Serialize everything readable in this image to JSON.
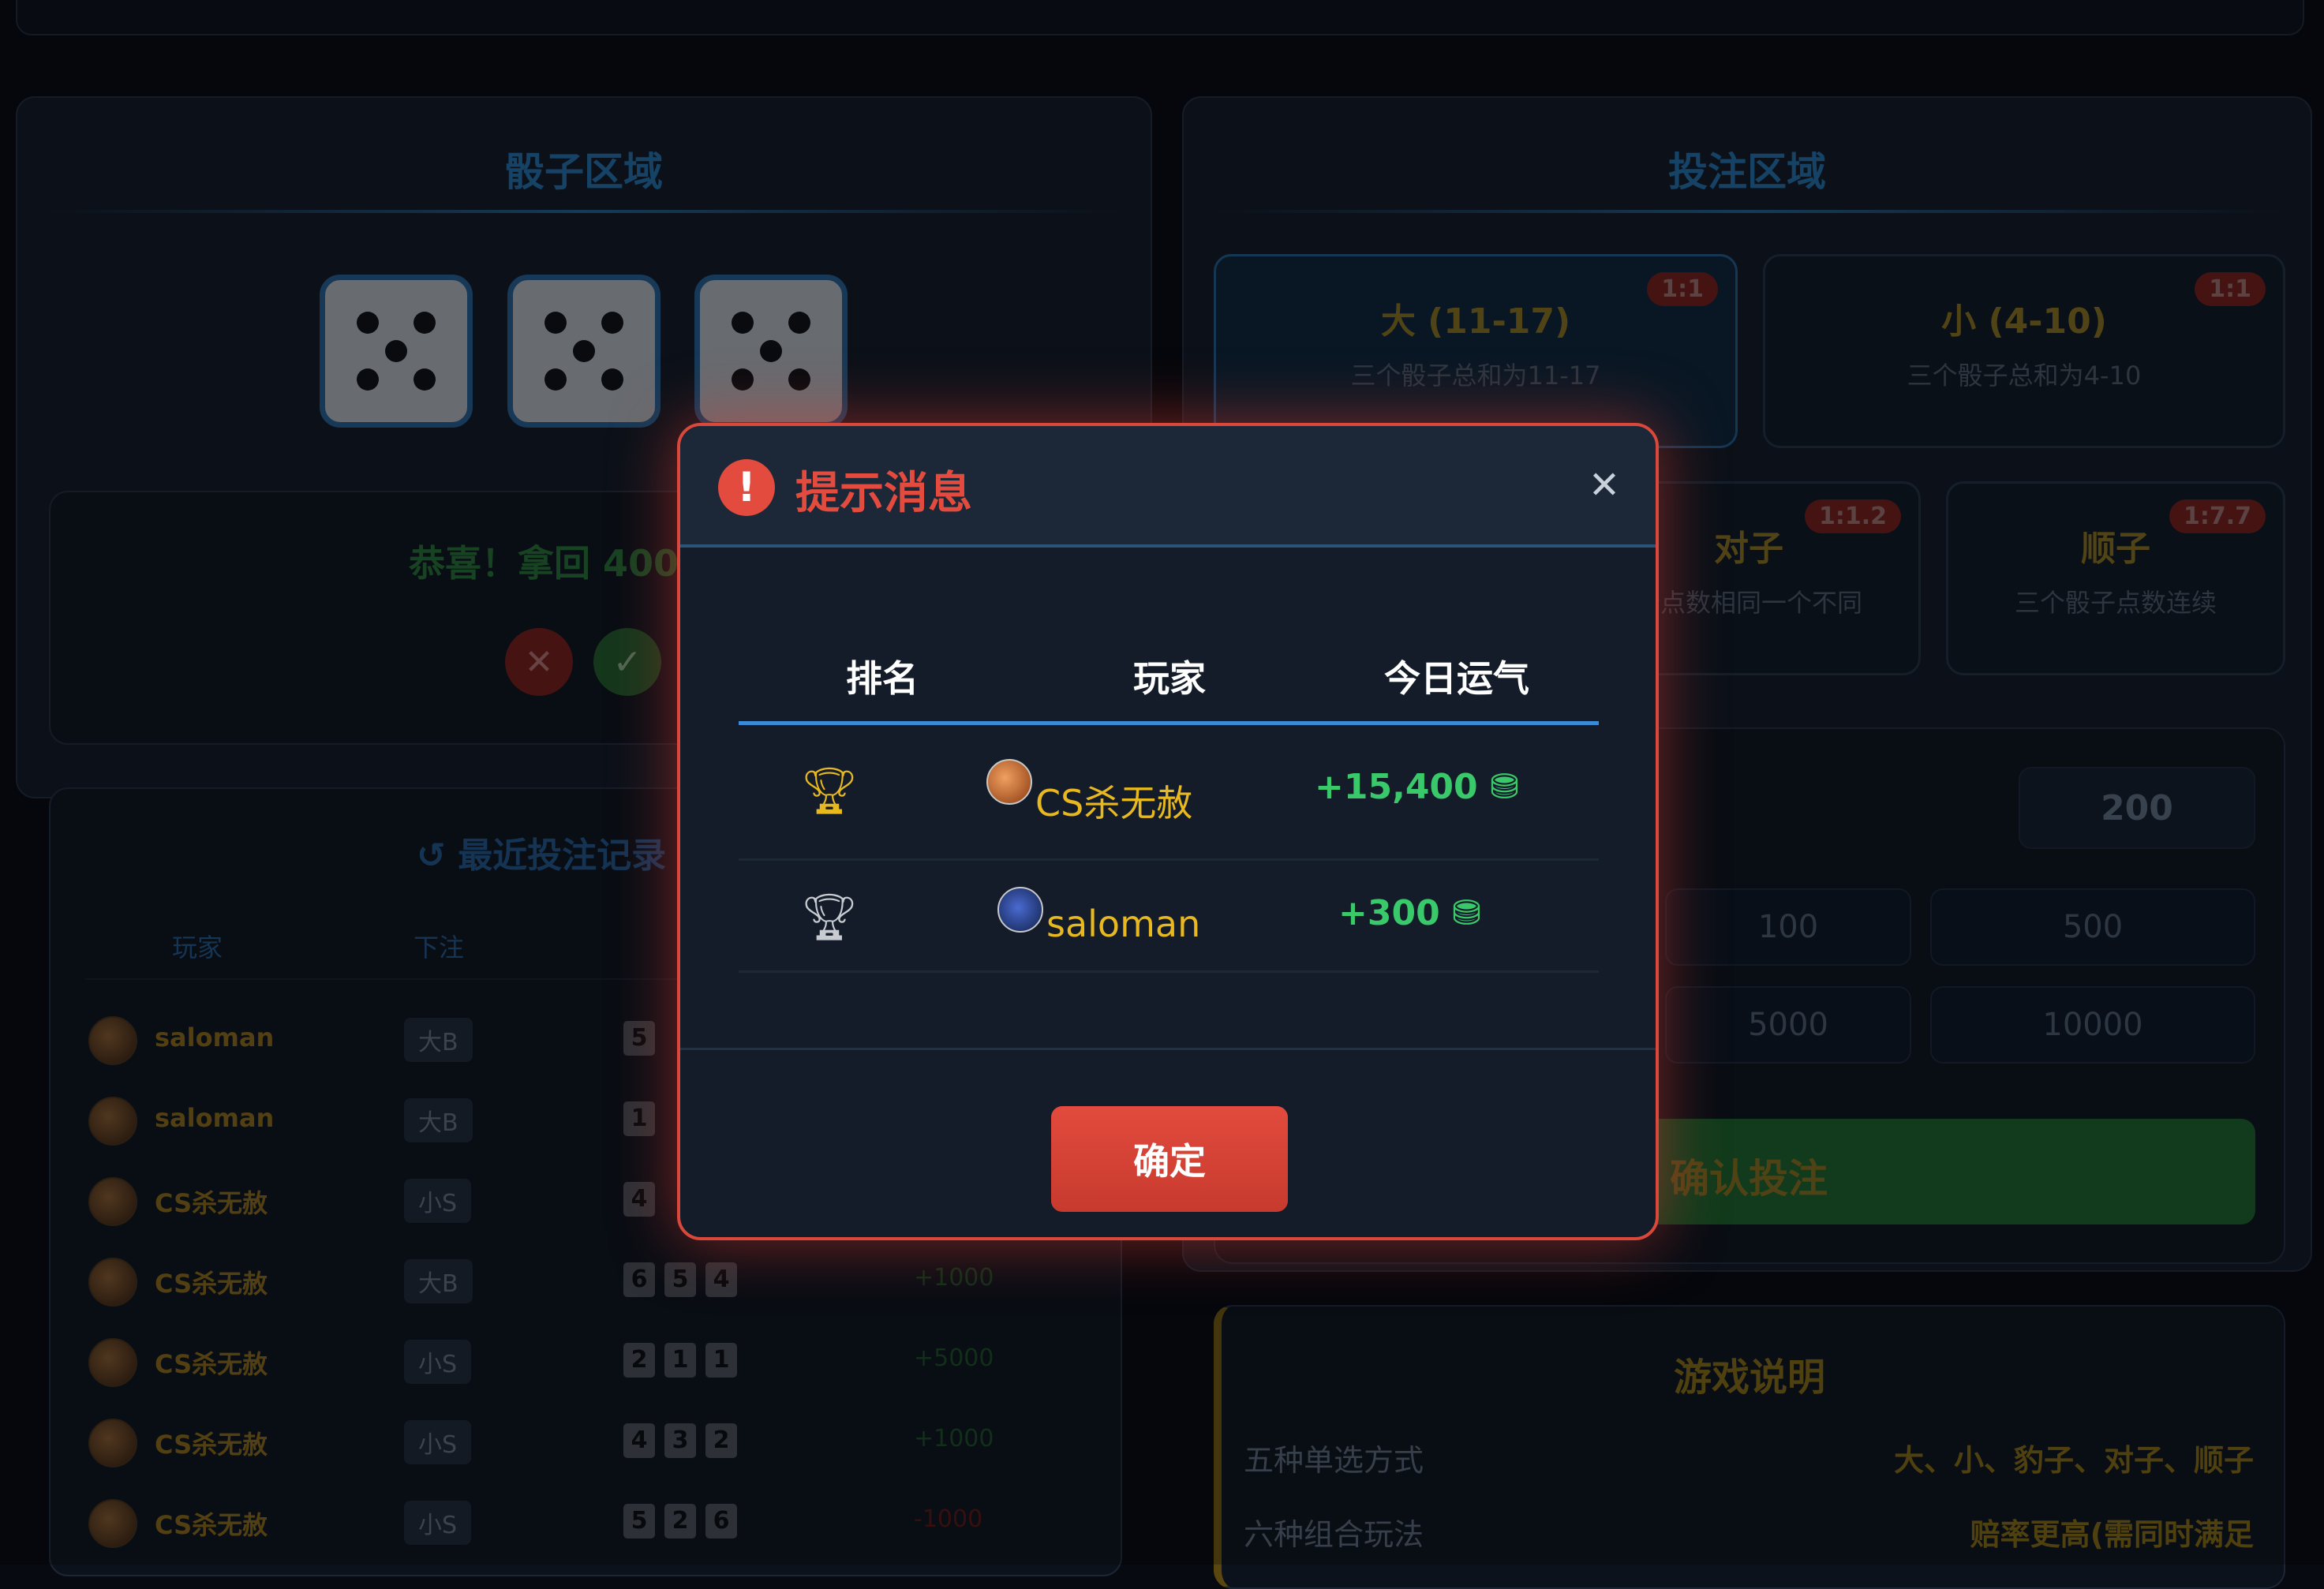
{
  "dice_section": {
    "title": "骰子区域",
    "dice": [
      5,
      5,
      5
    ],
    "result_text": "恭喜！拿回 400",
    "cancel_icon": "close-icon",
    "confirm_icon": "check-icon"
  },
  "bet_section": {
    "title": "投注区域",
    "options": [
      {
        "name": "大 (11-17)",
        "desc": "三个骰子总和为11-17",
        "odds": "1:1",
        "selected": true
      },
      {
        "name": "小 (4-10)",
        "desc": "三个骰子总和为4-10",
        "odds": "1:1",
        "selected": false
      },
      {
        "name": "对子",
        "desc": "个点数相同一个不同",
        "odds": "1:1.2",
        "selected": false
      },
      {
        "name": "顺子",
        "desc": "三个骰子点数连续",
        "odds": "1:7.7",
        "selected": false
      }
    ],
    "amount": "200",
    "chips": [
      "100",
      "500",
      "5000",
      "10000"
    ],
    "confirm_label": "确认投注"
  },
  "history": {
    "title": "最近投注记录",
    "columns": [
      "玩家",
      "下注"
    ],
    "rows": [
      {
        "player": "saloman",
        "bet": "大B",
        "dice": [
          "5"
        ],
        "result": ""
      },
      {
        "player": "saloman",
        "bet": "大B",
        "dice": [
          "1"
        ],
        "result": ""
      },
      {
        "player": "CS杀无赦",
        "bet": "小S",
        "dice": [
          "4"
        ],
        "result": ""
      },
      {
        "player": "CS杀无赦",
        "bet": "大B",
        "dice": [
          "6",
          "5",
          "4"
        ],
        "result": "+1000"
      },
      {
        "player": "CS杀无赦",
        "bet": "小S",
        "dice": [
          "2",
          "1",
          "1"
        ],
        "result": "+5000"
      },
      {
        "player": "CS杀无赦",
        "bet": "小S",
        "dice": [
          "4",
          "3",
          "2"
        ],
        "result": "+1000"
      },
      {
        "player": "CS杀无赦",
        "bet": "小S",
        "dice": [
          "5",
          "2",
          "6"
        ],
        "result": "-1000"
      }
    ]
  },
  "rules": {
    "title": "游戏说明",
    "items": [
      {
        "label": "五种单选方式",
        "value": "大、小、豹子、对子、顺子"
      },
      {
        "label": "六种组合玩法",
        "value": "赔率更高(需同时满足"
      }
    ]
  },
  "modal": {
    "title": "提示消息",
    "columns": [
      "排名",
      "玩家",
      "今日运气"
    ],
    "rows": [
      {
        "rank_icon": "gold-trophy-icon",
        "player": "CS杀无赦",
        "luck": "+15,400"
      },
      {
        "rank_icon": "silver-trophy-icon",
        "player": "saloman",
        "luck": "+300"
      }
    ],
    "ok_label": "确定"
  },
  "colors": {
    "accent_red": "#d9483b",
    "gold": "#e8b820",
    "green": "#39c86a",
    "blue_title": "#1e5a87"
  }
}
